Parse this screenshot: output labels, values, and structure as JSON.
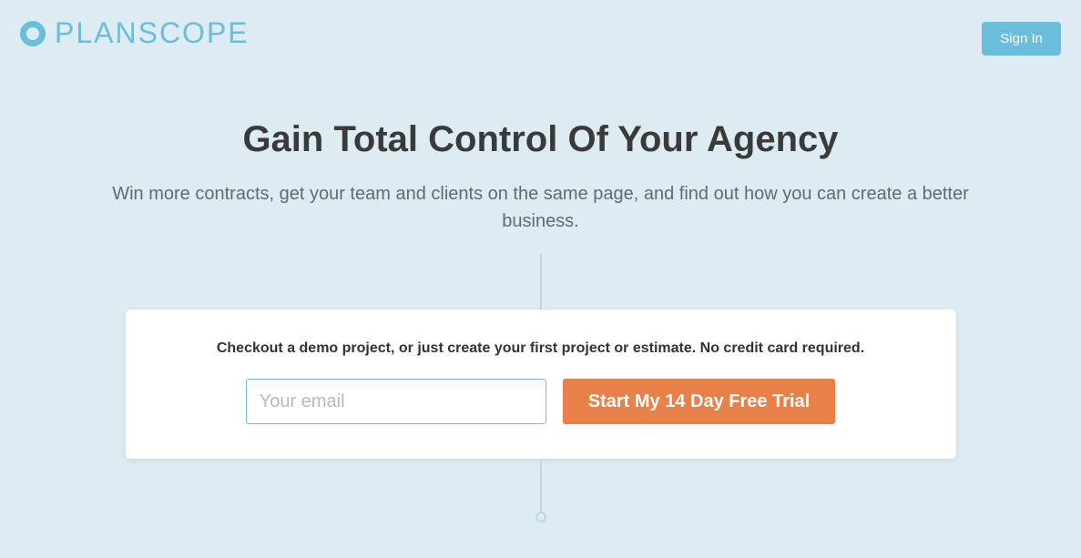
{
  "header": {
    "logo_text": "PLANSCOPE",
    "signin_label": "Sign In"
  },
  "hero": {
    "title": "Gain Total Control Of Your Agency",
    "subtitle": "Win more contracts, get your team and clients on the same page, and find out how you can create a better business."
  },
  "signup": {
    "card_text": "Checkout a demo project, or just create your first project or estimate. No credit card required.",
    "email_placeholder": "Your email",
    "trial_button_label": "Start My 14 Day Free Trial"
  }
}
